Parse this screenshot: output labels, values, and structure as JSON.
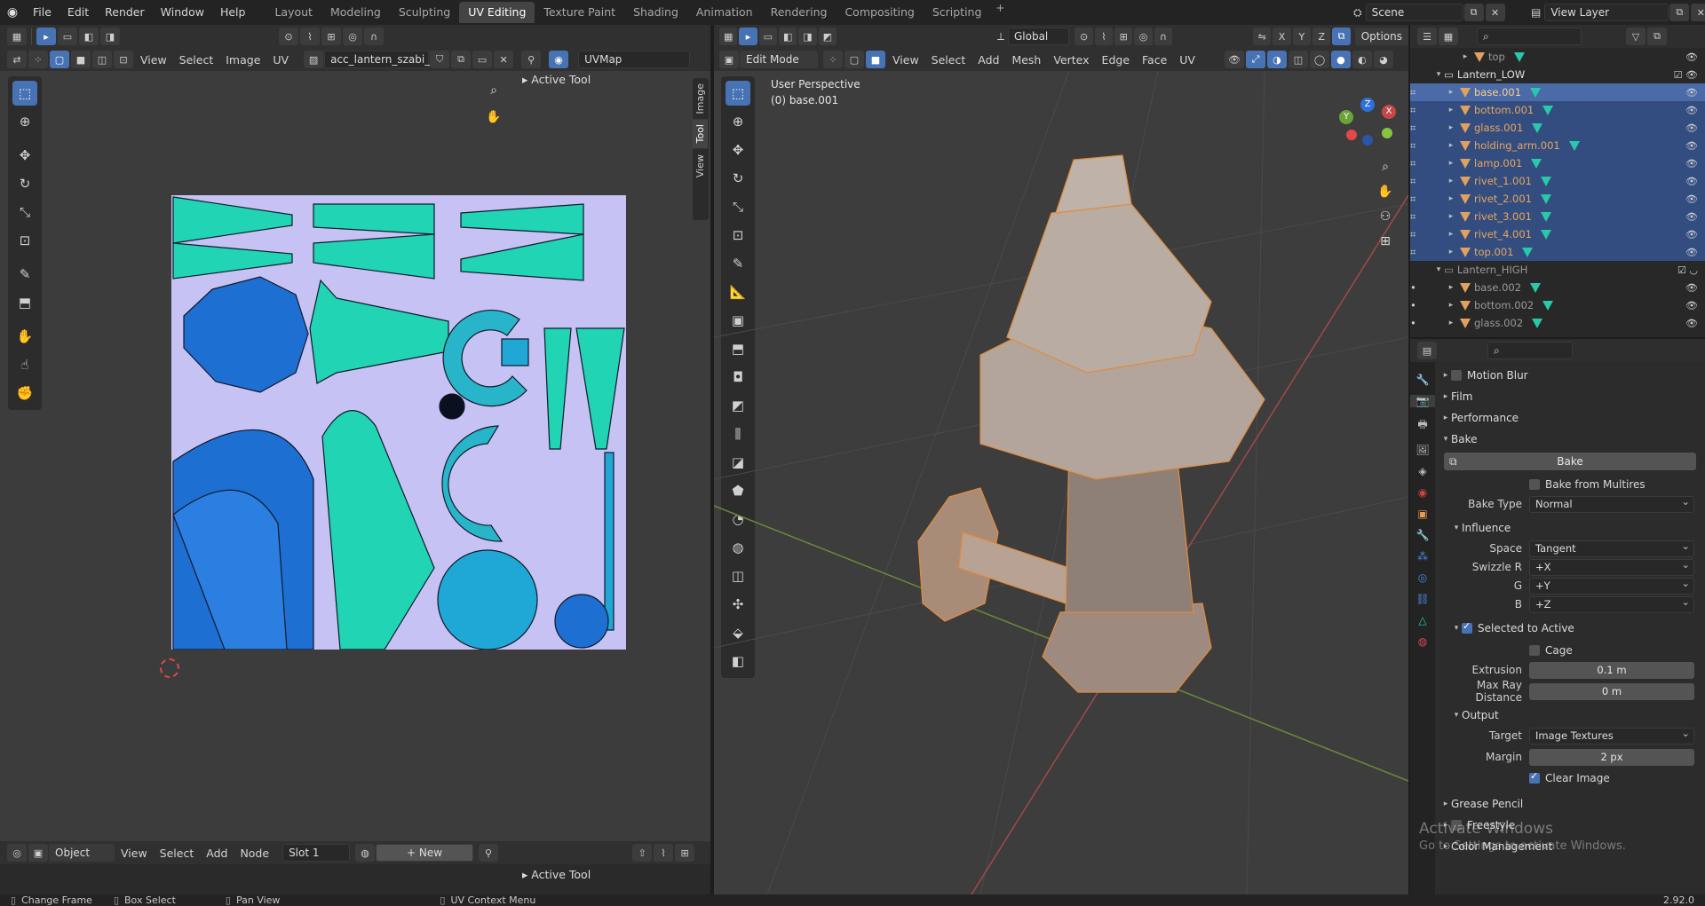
{
  "menubar": {
    "menus": [
      "File",
      "Edit",
      "Render",
      "Window",
      "Help"
    ],
    "workspaces": [
      "Layout",
      "Modeling",
      "Sculpting",
      "UV Editing",
      "Texture Paint",
      "Shading",
      "Animation",
      "Rendering",
      "Compositing",
      "Scripting"
    ],
    "active_workspace": "UV Editing",
    "scene": "Scene",
    "view_layer": "View Layer"
  },
  "uv_editor": {
    "menus": [
      "View",
      "Select",
      "Image",
      "UV"
    ],
    "image_name": "acc_lantern_szabi_N...",
    "uv_map": "UVMap",
    "side_tabs": [
      "Image",
      "Tool",
      "View"
    ],
    "active_tool_label": "Active Tool"
  },
  "viewport": {
    "mode": "Edit Mode",
    "menus": [
      "View",
      "Select",
      "Add",
      "Mesh",
      "Vertex",
      "Edge",
      "Face",
      "UV"
    ],
    "orientation": "Global",
    "options_label": "Options",
    "axes": [
      "X",
      "Y",
      "Z"
    ],
    "perspective_label": "User Perspective",
    "object_label": "(0) base.001",
    "gizmo_axes": [
      "Y",
      "X",
      "Z"
    ]
  },
  "outliner": {
    "rows": [
      {
        "name": "top",
        "level": 2,
        "style": "gray"
      },
      {
        "name": "Lantern_LOW",
        "level": 1,
        "style": "white",
        "collection": true
      },
      {
        "name": "base.001",
        "level": 2,
        "style": "orange",
        "selected": true,
        "active": true
      },
      {
        "name": "bottom.001",
        "level": 2,
        "style": "orange",
        "selected": true
      },
      {
        "name": "glass.001",
        "level": 2,
        "style": "orange",
        "selected": true
      },
      {
        "name": "holding_arm.001",
        "level": 2,
        "style": "orange",
        "selected": true
      },
      {
        "name": "lamp.001",
        "level": 2,
        "style": "orange",
        "selected": true
      },
      {
        "name": "rivet_1.001",
        "level": 2,
        "style": "orange",
        "selected": true
      },
      {
        "name": "rivet_2.001",
        "level": 2,
        "style": "orange",
        "selected": true
      },
      {
        "name": "rivet_3.001",
        "level": 2,
        "style": "orange",
        "selected": true
      },
      {
        "name": "rivet_4.001",
        "level": 2,
        "style": "orange",
        "selected": true
      },
      {
        "name": "top.001",
        "level": 2,
        "style": "orange",
        "selected": true
      },
      {
        "name": "Lantern_HIGH",
        "level": 1,
        "style": "gray",
        "collection": true
      },
      {
        "name": "base.002",
        "level": 2,
        "style": "gray"
      },
      {
        "name": "bottom.002",
        "level": 2,
        "style": "gray"
      },
      {
        "name": "glass.002",
        "level": 2,
        "style": "gray"
      }
    ]
  },
  "properties": {
    "panels": {
      "motion_blur": "Motion Blur",
      "film": "Film",
      "performance": "Performance",
      "bake": "Bake",
      "influence": "Influence",
      "output": "Output",
      "grease_pencil": "Grease Pencil",
      "freestyle": "Freestyle",
      "color_management": "Color Management"
    },
    "bake_button": "Bake",
    "bake_from_multires": "Bake from Multires",
    "bake_type_label": "Bake Type",
    "bake_type": "Normal",
    "space_label": "Space",
    "space": "Tangent",
    "swizzle_r_label": "Swizzle R",
    "swizzle_r": "+X",
    "g_label": "G",
    "swizzle_g": "+Y",
    "b_label": "B",
    "swizzle_b": "+Z",
    "selected_to_active": "Selected to Active",
    "cage": "Cage",
    "extrusion_label": "Extrusion",
    "extrusion": "0.1 m",
    "max_ray_label": "Max Ray Distance",
    "max_ray": "0 m",
    "target_label": "Target",
    "target": "Image Textures",
    "margin_label": "Margin",
    "margin": "2 px",
    "clear_image": "Clear Image"
  },
  "node_header": {
    "object": "Object",
    "menus": [
      "View",
      "Select",
      "Add",
      "Node"
    ],
    "slot": "Slot 1",
    "new": "New",
    "active_tool_label": "Active Tool"
  },
  "watermark": {
    "line1": "Activate Windows",
    "line2": "Go to Settings to activate Windows."
  },
  "statusbar": {
    "items": [
      "Change Frame",
      "Box Select",
      "Pan View",
      "UV Context Menu"
    ],
    "version": "2.92.0"
  },
  "colors": {
    "accent": "#4772b3",
    "selection_orange": "#e9a65a",
    "uv_background": "#c6c2f4",
    "uv_island_teal": "#21d4b4",
    "uv_island_blue": "#1d6fd2"
  }
}
